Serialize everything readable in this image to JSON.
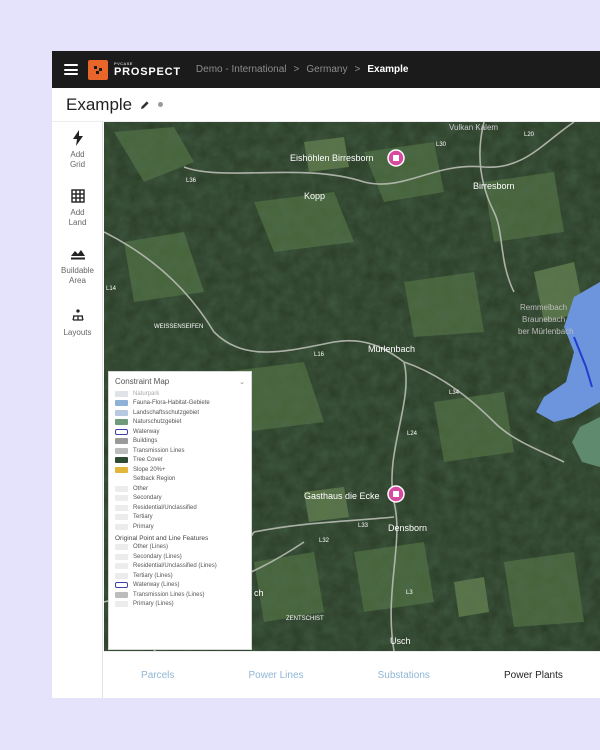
{
  "app": {
    "brand_small": "PVCASE",
    "brand_name": "PROSPECT",
    "breadcrumbs": [
      "Demo - International",
      "Germany",
      "Example"
    ],
    "separator": ">"
  },
  "project": {
    "title": "Example"
  },
  "toolbar": {
    "tools": [
      {
        "icon": "lightning-icon",
        "label": "Add\nGrid"
      },
      {
        "icon": "grid-icon",
        "label": "Add\nLand"
      },
      {
        "icon": "terrain-icon",
        "label": "Buildable\nArea"
      },
      {
        "icon": "solar-rows-icon",
        "label": "Layouts"
      }
    ]
  },
  "map": {
    "places": {
      "vulkan_kalem": "Vulkan Kalem",
      "eisholen": "Eishöhlen Birresborn",
      "birresborn": "Birresborn",
      "kopp": "Kopp",
      "weissenseifen": "WEISSENSEIFEN",
      "murlenbach": "Mürlenbach",
      "remmelbach_1": "Remmelbach",
      "remmelbach_2": "Braunebach",
      "remmelbach_3": "ber Mürlenbach",
      "gasthaus": "Gasthaus die Ecke",
      "densborn": "Densborn",
      "ch": "ch",
      "usch": "Usch",
      "zentschist": "ZENTSCHIST"
    },
    "roads": {
      "l30": "L30",
      "l36": "L36",
      "l14": "L14",
      "l24": "L24",
      "l16": "L16",
      "l33": "L33",
      "l3": "L3",
      "l32": "L32",
      "l34": "L34",
      "l20": "L20"
    }
  },
  "constraint_map": {
    "title": "Constraint Map",
    "layers": [
      {
        "label": "Naturpark",
        "color": "#dfe2e8",
        "style": "fill",
        "faint": true
      },
      {
        "label": "Fauna-Flora-Habitat-Gebiete",
        "color": "#8fb1d8",
        "style": "fill"
      },
      {
        "label": "Landschaftsschutzgebiet",
        "color": "#b8c8de",
        "style": "fill"
      },
      {
        "label": "Naturschutzgebiet",
        "color": "#6f9a7c",
        "style": "fill"
      },
      {
        "label": "Waterway",
        "color": "#3f3fa8",
        "style": "outline"
      },
      {
        "label": "Buildings",
        "color": "#9a9a9a",
        "style": "fill"
      },
      {
        "label": "Transmission Lines",
        "color": "#bcbcbc",
        "style": "dashes"
      },
      {
        "label": "Tree Cover",
        "color": "#2f4b33",
        "style": "fill"
      },
      {
        "label": "Slope 20%+",
        "color": "#e3b53a",
        "style": "fill"
      }
    ],
    "setback": {
      "title": "Setback Region",
      "items": [
        {
          "label": "Other",
          "color": "#ececec"
        },
        {
          "label": "Secondary",
          "color": "#ececec"
        },
        {
          "label": "Residential/Unclassified",
          "color": "#ececec"
        },
        {
          "label": "Tertiary",
          "color": "#ececec"
        },
        {
          "label": "Primary",
          "color": "#ececec"
        }
      ]
    },
    "features": {
      "title": "Original Point and Line Features",
      "items": [
        {
          "label": "Other (Lines)",
          "color": "#ececec",
          "style": "fill"
        },
        {
          "label": "Secondary (Lines)",
          "color": "#ececec",
          "style": "fill"
        },
        {
          "label": "Residential/Unclassified (Lines)",
          "color": "#ececec",
          "style": "fill"
        },
        {
          "label": "Tertiary (Lines)",
          "color": "#ececec",
          "style": "fill"
        },
        {
          "label": "Waterway (Lines)",
          "color": "#3f3fa8",
          "style": "outline"
        },
        {
          "label": "Transmission Lines (Lines)",
          "color": "#bcbcbc",
          "style": "dashes"
        },
        {
          "label": "Primary (Lines)",
          "color": "#ececec",
          "style": "fill"
        }
      ]
    }
  },
  "tabs": [
    {
      "label": "Parcels",
      "active": false
    },
    {
      "label": "Power Lines",
      "active": false
    },
    {
      "label": "Substations",
      "active": false
    },
    {
      "label": "Power Plants",
      "active": true
    }
  ],
  "colors": {
    "accent": "#e8662a",
    "background": "#e5e3fb",
    "topbar": "#1b1b1b",
    "water": "#6d95dd",
    "river": "#1f3fcf",
    "poi": "#d84aa0"
  }
}
